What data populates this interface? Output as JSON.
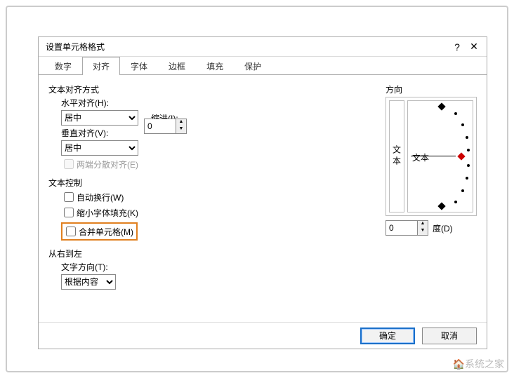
{
  "dialog": {
    "title": "设置单元格格式",
    "help": "?",
    "close": "✕"
  },
  "tabs": [
    "数字",
    "对齐",
    "字体",
    "边框",
    "填充",
    "保护"
  ],
  "activeTabIndex": 1,
  "align": {
    "group_label": "文本对齐方式",
    "h_label": "水平对齐(H):",
    "h_value": "居中",
    "indent_label": "缩进(I):",
    "indent_value": "0",
    "v_label": "垂直对齐(V):",
    "v_value": "居中",
    "justify_distributed": "两端分散对齐(E)"
  },
  "control": {
    "group_label": "文本控制",
    "wrap": "自动换行(W)",
    "shrink": "缩小字体填充(K)",
    "merge": "合并单元格(M)"
  },
  "rtl": {
    "group_label": "从右到左",
    "dir_label": "文字方向(T):",
    "dir_value": "根据内容"
  },
  "orientation": {
    "group_label": "方向",
    "vertical_text": "文本",
    "center_text": "文本",
    "degree_value": "0",
    "degree_label": "度(D)"
  },
  "footer": {
    "ok": "确定",
    "cancel": "取消"
  },
  "watermark": "🏠系统之家"
}
